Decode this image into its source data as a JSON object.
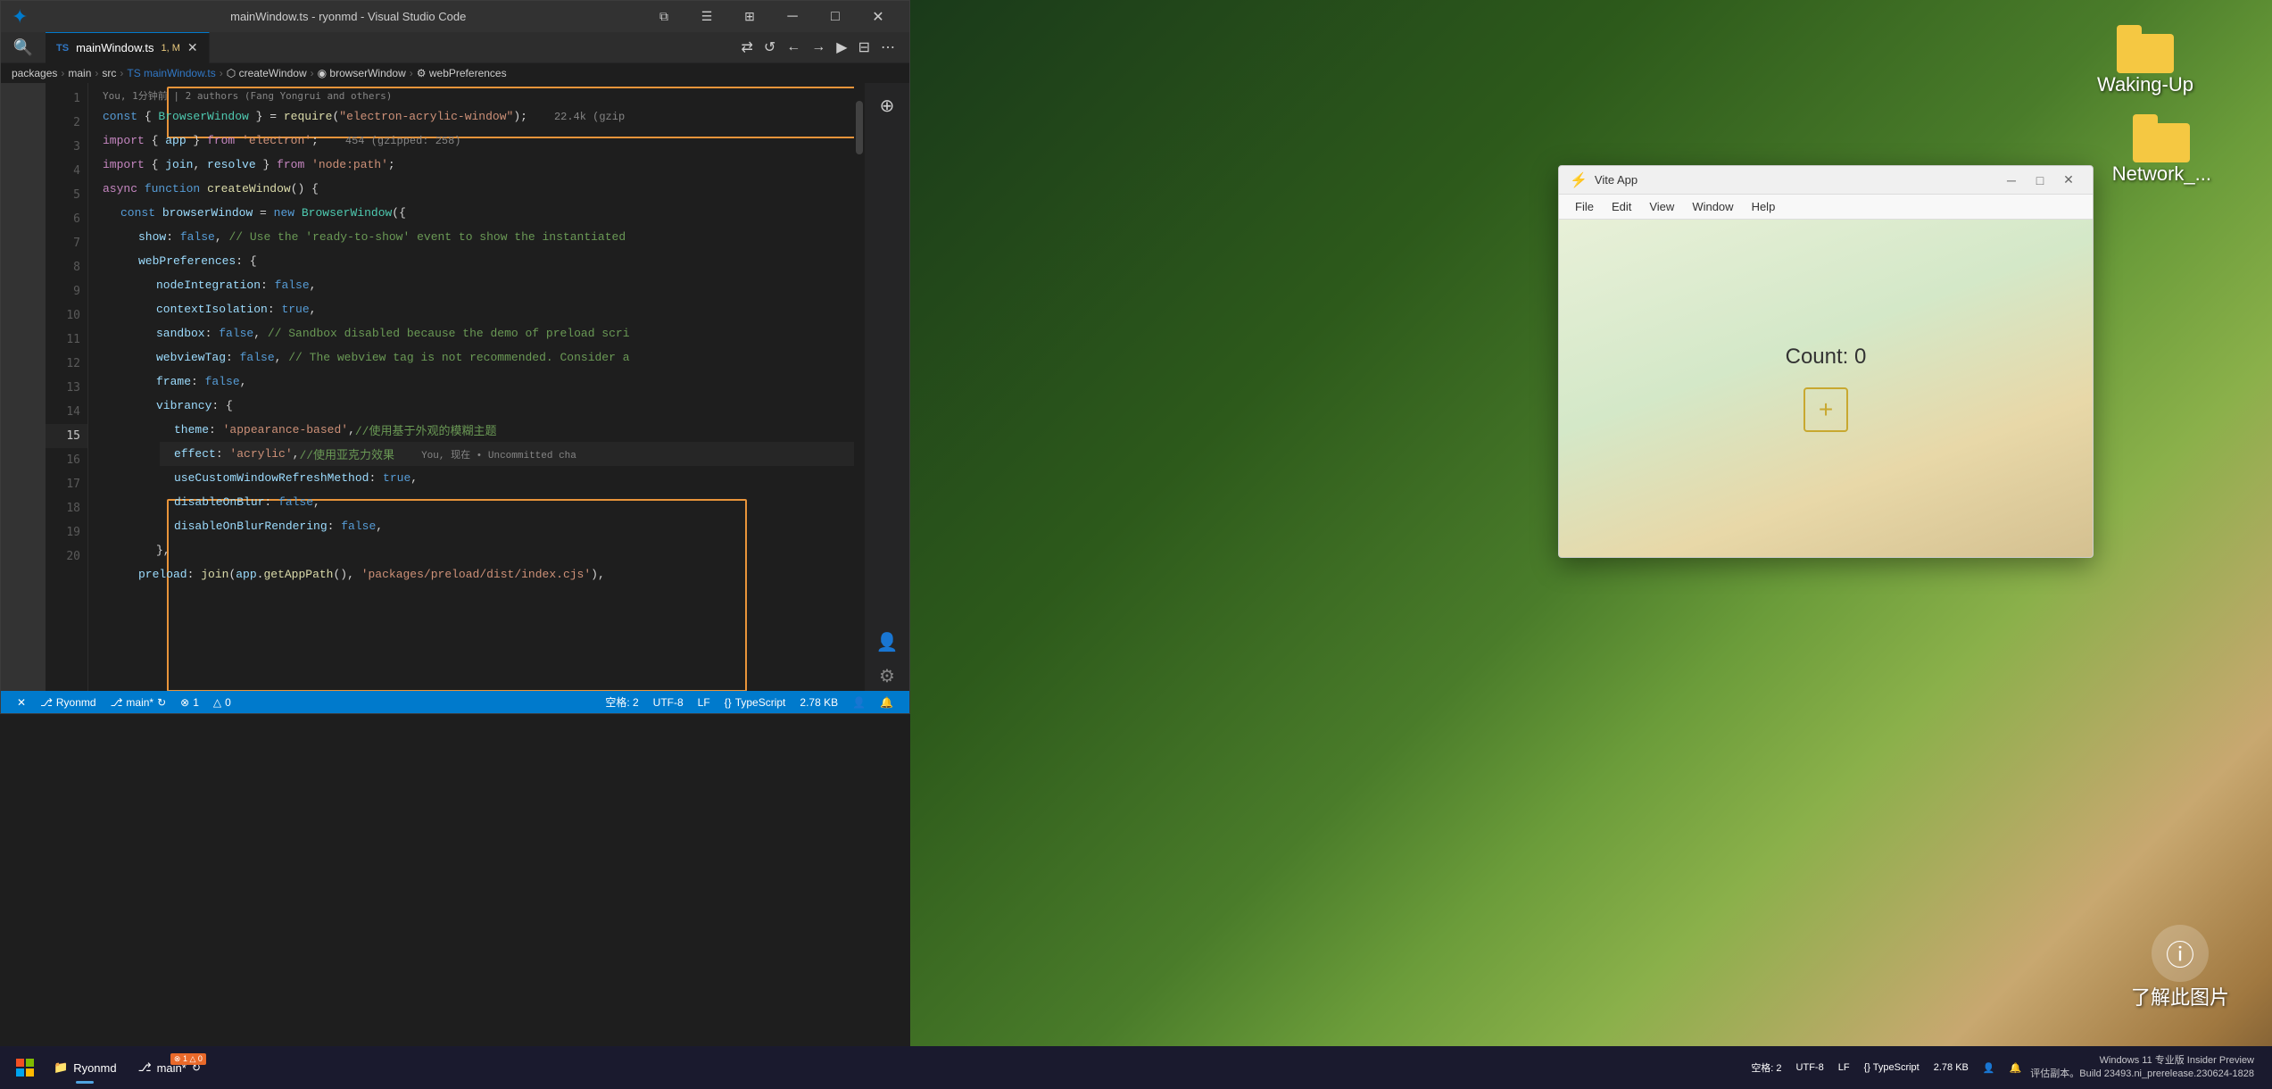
{
  "titlebar": {
    "title": "mainWindow.ts - ryonmd - Visual Studio Code",
    "minimize": "─",
    "maximize": "□",
    "close": "✕",
    "menu_items": []
  },
  "tabs": {
    "active_tab": {
      "lang": "TS",
      "filename": "mainWindow.ts",
      "markers": "1, M",
      "close": "✕"
    }
  },
  "toolbar": {
    "buttons": [
      "⇄",
      "↺",
      "←",
      "→",
      "▶",
      "⊟",
      "⋯"
    ]
  },
  "breadcrumb": {
    "items": [
      "packages",
      ">",
      "main",
      ">",
      "src",
      ">",
      "TS mainWindow.ts",
      ">",
      "⬡ createWindow",
      ">",
      "◉ browserWindow",
      ">",
      "⚙ webPreferences"
    ]
  },
  "git_blame": {
    "text": "You, 1分钟前 | 2 authors (Fang Yongrui and others)"
  },
  "code_lines": [
    {
      "num": 1,
      "content": "const { BrowserWindow } = require(\"electron-acrylic-window\");",
      "badge": "22.4k (gzip"
    },
    {
      "num": 2,
      "content": "import { app } from 'electron';",
      "badge": "454 (gzipped: 258)"
    },
    {
      "num": 3,
      "content": "import { join, resolve } from 'node:path';"
    },
    {
      "num": 4,
      "content": "async function createWindow() {"
    },
    {
      "num": 5,
      "content": "  const browserWindow = new BrowserWindow({"
    },
    {
      "num": 6,
      "content": "    show: false, // Use the 'ready-to-show' event to show the instantiated"
    },
    {
      "num": 7,
      "content": "    webPreferences: {"
    },
    {
      "num": 8,
      "content": "      nodeIntegration: false,"
    },
    {
      "num": 9,
      "content": "      contextIsolation: true,"
    },
    {
      "num": 10,
      "content": "      sandbox: false, // Sandbox disabled because the demo of preload scri"
    },
    {
      "num": 11,
      "content": "      webviewTag: false, // The webview tag is not recommended. Consider a"
    },
    {
      "num": 12,
      "content": "      frame: false,"
    },
    {
      "num": 13,
      "content": "      vibrancy: {"
    },
    {
      "num": 14,
      "content": "        theme: 'appearance-based',//使用基于外观的模糊主题"
    },
    {
      "num": 15,
      "content": "        effect: 'acrylic',//使用亚克力效果",
      "inline": "You, 现在 • Uncommitted cha"
    },
    {
      "num": 16,
      "content": "        useCustomWindowRefreshMethod: true,"
    },
    {
      "num": 17,
      "content": "        disableOnBlur: false,"
    },
    {
      "num": 18,
      "content": "        disableOnBlurRendering: false,"
    },
    {
      "num": 19,
      "content": "      },"
    },
    {
      "num": 20,
      "content": "    preload: join(app.getAppPath(), 'packages/preload/dist/index.cjs'),"
    }
  ],
  "vite_app": {
    "title": "Vite App",
    "menu": [
      "File",
      "Edit",
      "View",
      "Window",
      "Help"
    ],
    "count_label": "Count: 0",
    "plus_btn": "+"
  },
  "statusbar": {
    "branch": "⎇ main*",
    "sync": "↻",
    "warning": "⊗ 1",
    "error": "△ 0",
    "spaces": "空格: 2",
    "encoding": "UTF-8",
    "line_ending": "LF",
    "lang": "TypeScript",
    "filesize": "2.78 KB",
    "account": "👤",
    "notif": "🔔"
  },
  "taskbar": {
    "start_icon": "⊞",
    "apps": [
      {
        "label": "Ryonmd",
        "icon": "📁",
        "active": true
      },
      {
        "label": "main*",
        "icon": "⎇",
        "active": false
      }
    ],
    "sys_items": [
      "空格: 2",
      "UTF-8",
      "LF",
      "{} TypeScript",
      "2.78 KB"
    ],
    "notifications": "🔔"
  },
  "win11_info": {
    "line1": "Windows 11 专业版 Insider Preview",
    "line2": "评估副本。Build 23493.ni_prerelease.230624-1828"
  },
  "desktop_icons": [
    {
      "label": "Waking-Up",
      "type": "folder"
    },
    {
      "label": "Network_...",
      "type": "folder"
    },
    {
      "label": "了解此图片",
      "type": "info"
    }
  ]
}
